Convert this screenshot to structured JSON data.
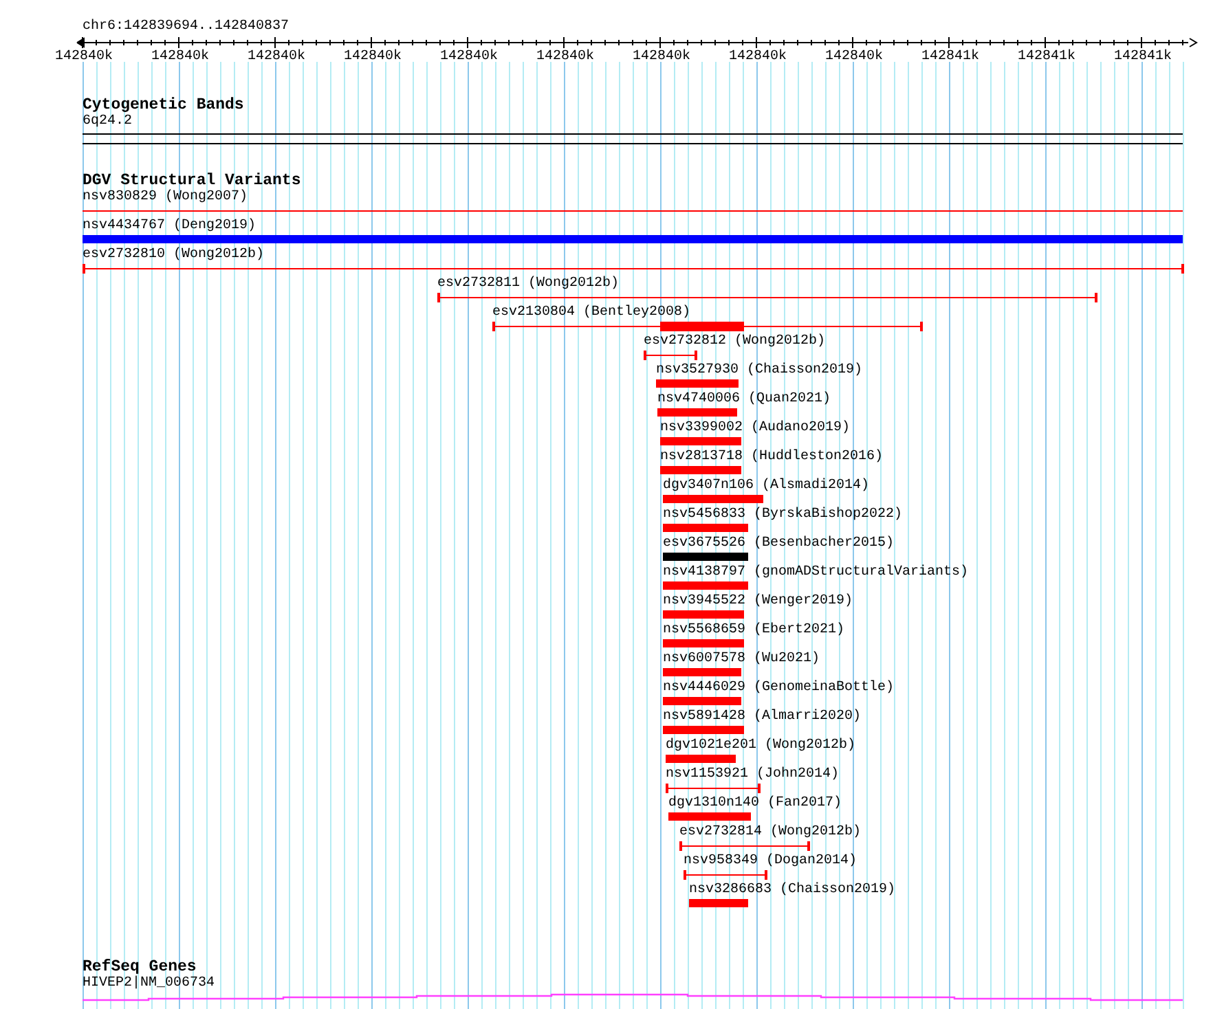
{
  "location": "chr6:142839694..142840837",
  "ruler": {
    "ticks": [
      "142840k",
      "142840k",
      "142840k",
      "142840k",
      "142840k",
      "142840k",
      "142840k",
      "142840k",
      "142840k",
      "142841k",
      "142841k",
      "142841k"
    ]
  },
  "tracks": [
    {
      "kind": "bands",
      "title": "Cytogenetic Bands",
      "features": [
        {
          "label": "6q24.2"
        }
      ]
    },
    {
      "kind": "variants",
      "title": "DGV Structural Variants",
      "features": [
        {
          "label": "nsv830829 (Wong2007)",
          "kind": "line",
          "color": "#ff0000"
        },
        {
          "label": "nsv4434767 (Deng2019)",
          "kind": "bar",
          "color": "#0000ff"
        },
        {
          "label": "esv2732810 (Wong2012b)",
          "kind": "capped",
          "color": "#ff0000"
        },
        {
          "label": "esv2732811 (Wong2012b)",
          "kind": "capped",
          "color": "#ff0000"
        },
        {
          "label": "esv2130804 (Bentley2008)",
          "kind": "capped-core",
          "color": "#ff0000"
        },
        {
          "label": "esv2732812 (Wong2012b)",
          "kind": "capped",
          "color": "#ff0000"
        },
        {
          "label": "nsv3527930 (Chaisson2019)",
          "kind": "bar",
          "color": "#ff0000"
        },
        {
          "label": "nsv4740006 (Quan2021)",
          "kind": "bar",
          "color": "#ff0000"
        },
        {
          "label": "nsv3399002 (Audano2019)",
          "kind": "bar",
          "color": "#ff0000"
        },
        {
          "label": "nsv2813718 (Huddleston2016)",
          "kind": "bar",
          "color": "#ff0000"
        },
        {
          "label": "dgv3407n106 (Alsmadi2014)",
          "kind": "bar",
          "color": "#ff0000"
        },
        {
          "label": "nsv5456833 (ByrskaBishop2022)",
          "kind": "bar",
          "color": "#ff0000"
        },
        {
          "label": "esv3675526 (Besenbacher2015)",
          "kind": "bar",
          "color": "#000000"
        },
        {
          "label": "nsv4138797 (gnomADStructuralVariants)",
          "kind": "bar",
          "color": "#ff0000"
        },
        {
          "label": "nsv3945522 (Wenger2019)",
          "kind": "bar",
          "color": "#ff0000"
        },
        {
          "label": "nsv5568659 (Ebert2021)",
          "kind": "bar",
          "color": "#ff0000"
        },
        {
          "label": "nsv6007578 (Wu2021)",
          "kind": "bar",
          "color": "#ff0000"
        },
        {
          "label": "nsv4446029 (GenomeinaBottle)",
          "kind": "bar",
          "color": "#ff0000"
        },
        {
          "label": "nsv5891428 (Almarri2020)",
          "kind": "bar",
          "color": "#ff0000"
        },
        {
          "label": "dgv1021e201 (Wong2012b)",
          "kind": "bar",
          "color": "#ff0000"
        },
        {
          "label": "nsv1153921 (John2014)",
          "kind": "capped",
          "color": "#ff0000"
        },
        {
          "label": "dgv1310n140 (Fan2017)",
          "kind": "bar",
          "color": "#ff0000"
        },
        {
          "label": "esv2732814 (Wong2012b)",
          "kind": "capped",
          "color": "#ff0000"
        },
        {
          "label": "nsv958349 (Dogan2014)",
          "kind": "capped",
          "color": "#ff0000"
        },
        {
          "label": "nsv3286683 (Chaisson2019)",
          "kind": "bar",
          "color": "#ff0000"
        }
      ]
    },
    {
      "kind": "genes",
      "title": "RefSeq Genes",
      "features": [
        {
          "label": "HIVEP2|NM_006734"
        }
      ]
    }
  ]
}
